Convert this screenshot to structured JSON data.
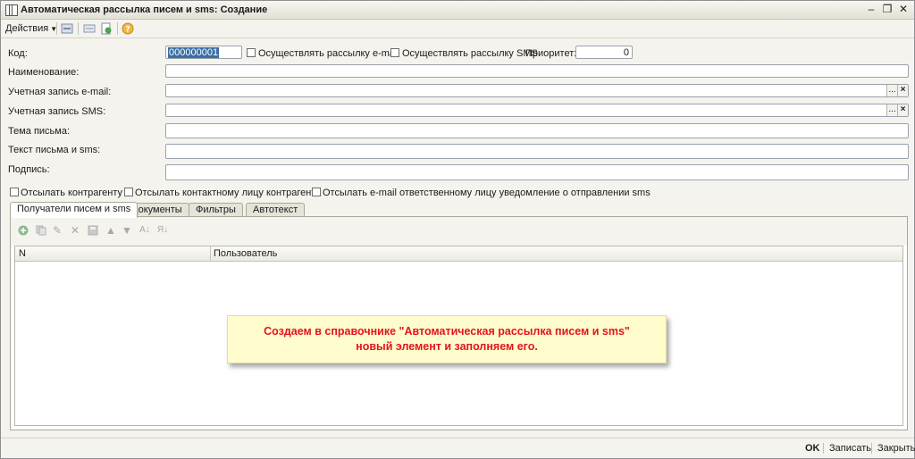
{
  "window": {
    "title": "Автоматическая рассылка писем и sms: Создание"
  },
  "toolbar": {
    "actions_label": "Действия",
    "help_icon": "question-icon"
  },
  "form": {
    "code_label": "Код:",
    "code_value": "000000001",
    "send_email_label": "Осуществлять рассылку e-mail",
    "send_sms_label": "Осуществлять рассылку SMS",
    "priority_label": "Приоритет:",
    "priority_value": "0",
    "name_label": "Наименование:",
    "email_account_label": "Учетная запись e-mail:",
    "sms_account_label": "Учетная запись SMS:",
    "subject_label": "Тема письма:",
    "text_label": "Текст письма и sms:",
    "signature_label": "Подпись:",
    "select_btn": "...",
    "clear_btn": "×",
    "to_contractor_label": "Отсылать контрагенту",
    "to_contact_label": "Отсылать контактному лицу контрагента",
    "notify_responsible_label": "Отсылать e-mail ответственному лицу уведомление о отправлении sms"
  },
  "tabs": [
    {
      "label": "Получатели писем и sms",
      "active": true
    },
    {
      "label": "Документы",
      "active": false
    },
    {
      "label": "Фильтры",
      "active": false
    },
    {
      "label": "Автотекст",
      "active": false
    }
  ],
  "grid": {
    "col_n": "N",
    "col_user": "Пользователь"
  },
  "callout": {
    "line1": "Создаем в справочнике \"Автоматическая рассылка писем и sms\"",
    "line2": "новый элемент и заполняем его."
  },
  "footer": {
    "ok_label": "OK",
    "save_label": "Записать",
    "close_label": "Закрыть"
  },
  "colors": {
    "callout_bg": "#fffccd",
    "callout_text": "#e3141d",
    "selection": "#3a6ea5"
  }
}
